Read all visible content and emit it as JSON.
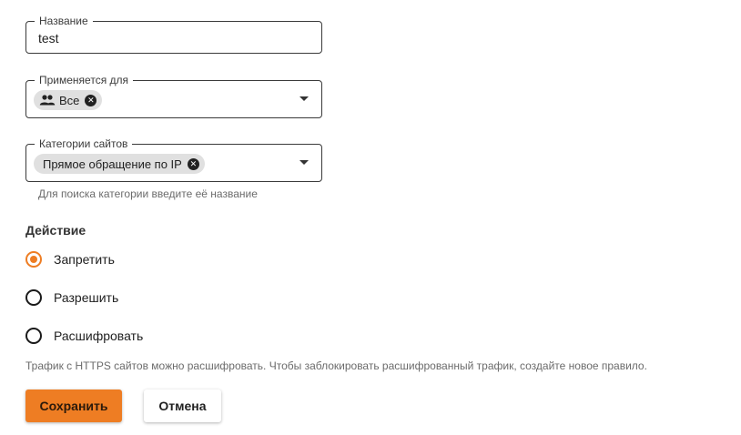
{
  "form": {
    "name_field": {
      "label": "Название",
      "value": "test"
    },
    "applies_field": {
      "label": "Применяется для",
      "chip": {
        "label": "Все",
        "icon": "people-icon"
      }
    },
    "categories_field": {
      "label": "Категории сайтов",
      "chip": {
        "label": "Прямое обращение по IP"
      },
      "helper": "Для поиска категории введите её название"
    },
    "action": {
      "title": "Действие",
      "options": [
        {
          "label": "Запретить",
          "checked": true
        },
        {
          "label": "Разрешить",
          "checked": false
        },
        {
          "label": "Расшифровать",
          "checked": false
        }
      ],
      "note": "Трафик с HTTPS сайтов можно расшифровать. Чтобы заблокировать расшифрованный трафик, создайте новое правило."
    },
    "buttons": {
      "save": "Сохранить",
      "cancel": "Отмена"
    }
  },
  "colors": {
    "accent": "#ee7d23",
    "chip_bg": "#e0e0e0"
  }
}
